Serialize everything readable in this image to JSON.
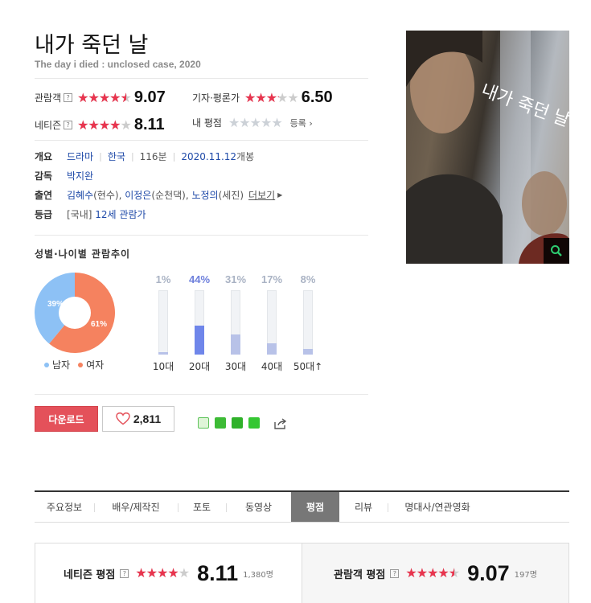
{
  "movie": {
    "title": "내가 죽던 날",
    "subtitle": "The day i died : unclosed case, 2020"
  },
  "scores": {
    "audience": {
      "label": "관람객",
      "value": "9.07",
      "rating": 9.07
    },
    "critic": {
      "label": "기자·평론가",
      "value": "6.50",
      "rating": 6.5
    },
    "netizen": {
      "label": "네티즌",
      "value": "8.11",
      "rating": 8.11
    },
    "mine": {
      "label": "내 평점",
      "register": "등록"
    },
    "help_glyph": "?"
  },
  "info": {
    "overview_label": "개요",
    "genre": "드라마",
    "country": "한국",
    "runtime": "116분",
    "release": "2020.11.12",
    "release_suffix": "개봉",
    "director_label": "감독",
    "director": "박지완",
    "cast_label": "출연",
    "cast": [
      {
        "name": "김혜수",
        "role": "(현수)"
      },
      {
        "name": "이정은",
        "role": "(순천댁)"
      },
      {
        "name": "노정의",
        "role": "(세진)"
      }
    ],
    "cast_more": "더보기",
    "rating_label": "등급",
    "rating_region": "[국내]",
    "rating_value": "12세 관람가"
  },
  "trend": {
    "title": "성별·나이별 관람추이",
    "gender": {
      "male_pct_label": "39%",
      "female_pct_label": "61%",
      "male_pct": 39,
      "female_pct": 61,
      "male_label": "남자",
      "female_label": "여자"
    },
    "ages": [
      {
        "label": "10대",
        "pct_label": "1%",
        "pct": 1,
        "highlight": false
      },
      {
        "label": "20대",
        "pct_label": "44%",
        "pct": 44,
        "highlight": true
      },
      {
        "label": "30대",
        "pct_label": "31%",
        "pct": 31,
        "highlight": false
      },
      {
        "label": "40대",
        "pct_label": "17%",
        "pct": 17,
        "highlight": false
      },
      {
        "label": "50대↑",
        "pct_label": "8%",
        "pct": 8,
        "highlight": false
      }
    ],
    "colors": {
      "male": "#8dc1f5",
      "female": "#f5825f",
      "bar": "#b8c2e8",
      "bar_highlight": "#6f86ea"
    }
  },
  "actions": {
    "download": "다운로드",
    "like_count": "2,811"
  },
  "poster": {
    "title_text": "내가 죽던 날"
  },
  "tabs": [
    "주요정보",
    "배우/제작진",
    "포토",
    "동영상",
    "평점",
    "리뷰",
    "명대사/연관영화"
  ],
  "active_tab": "평점",
  "summary": {
    "netizen_label": "네티즌 평점",
    "netizen_score": "8.11",
    "netizen_rating": 8.11,
    "netizen_count": "1,380명",
    "audience_label": "관람객 평점",
    "audience_score": "9.07",
    "audience_rating": 9.07,
    "audience_count": "197명"
  }
}
